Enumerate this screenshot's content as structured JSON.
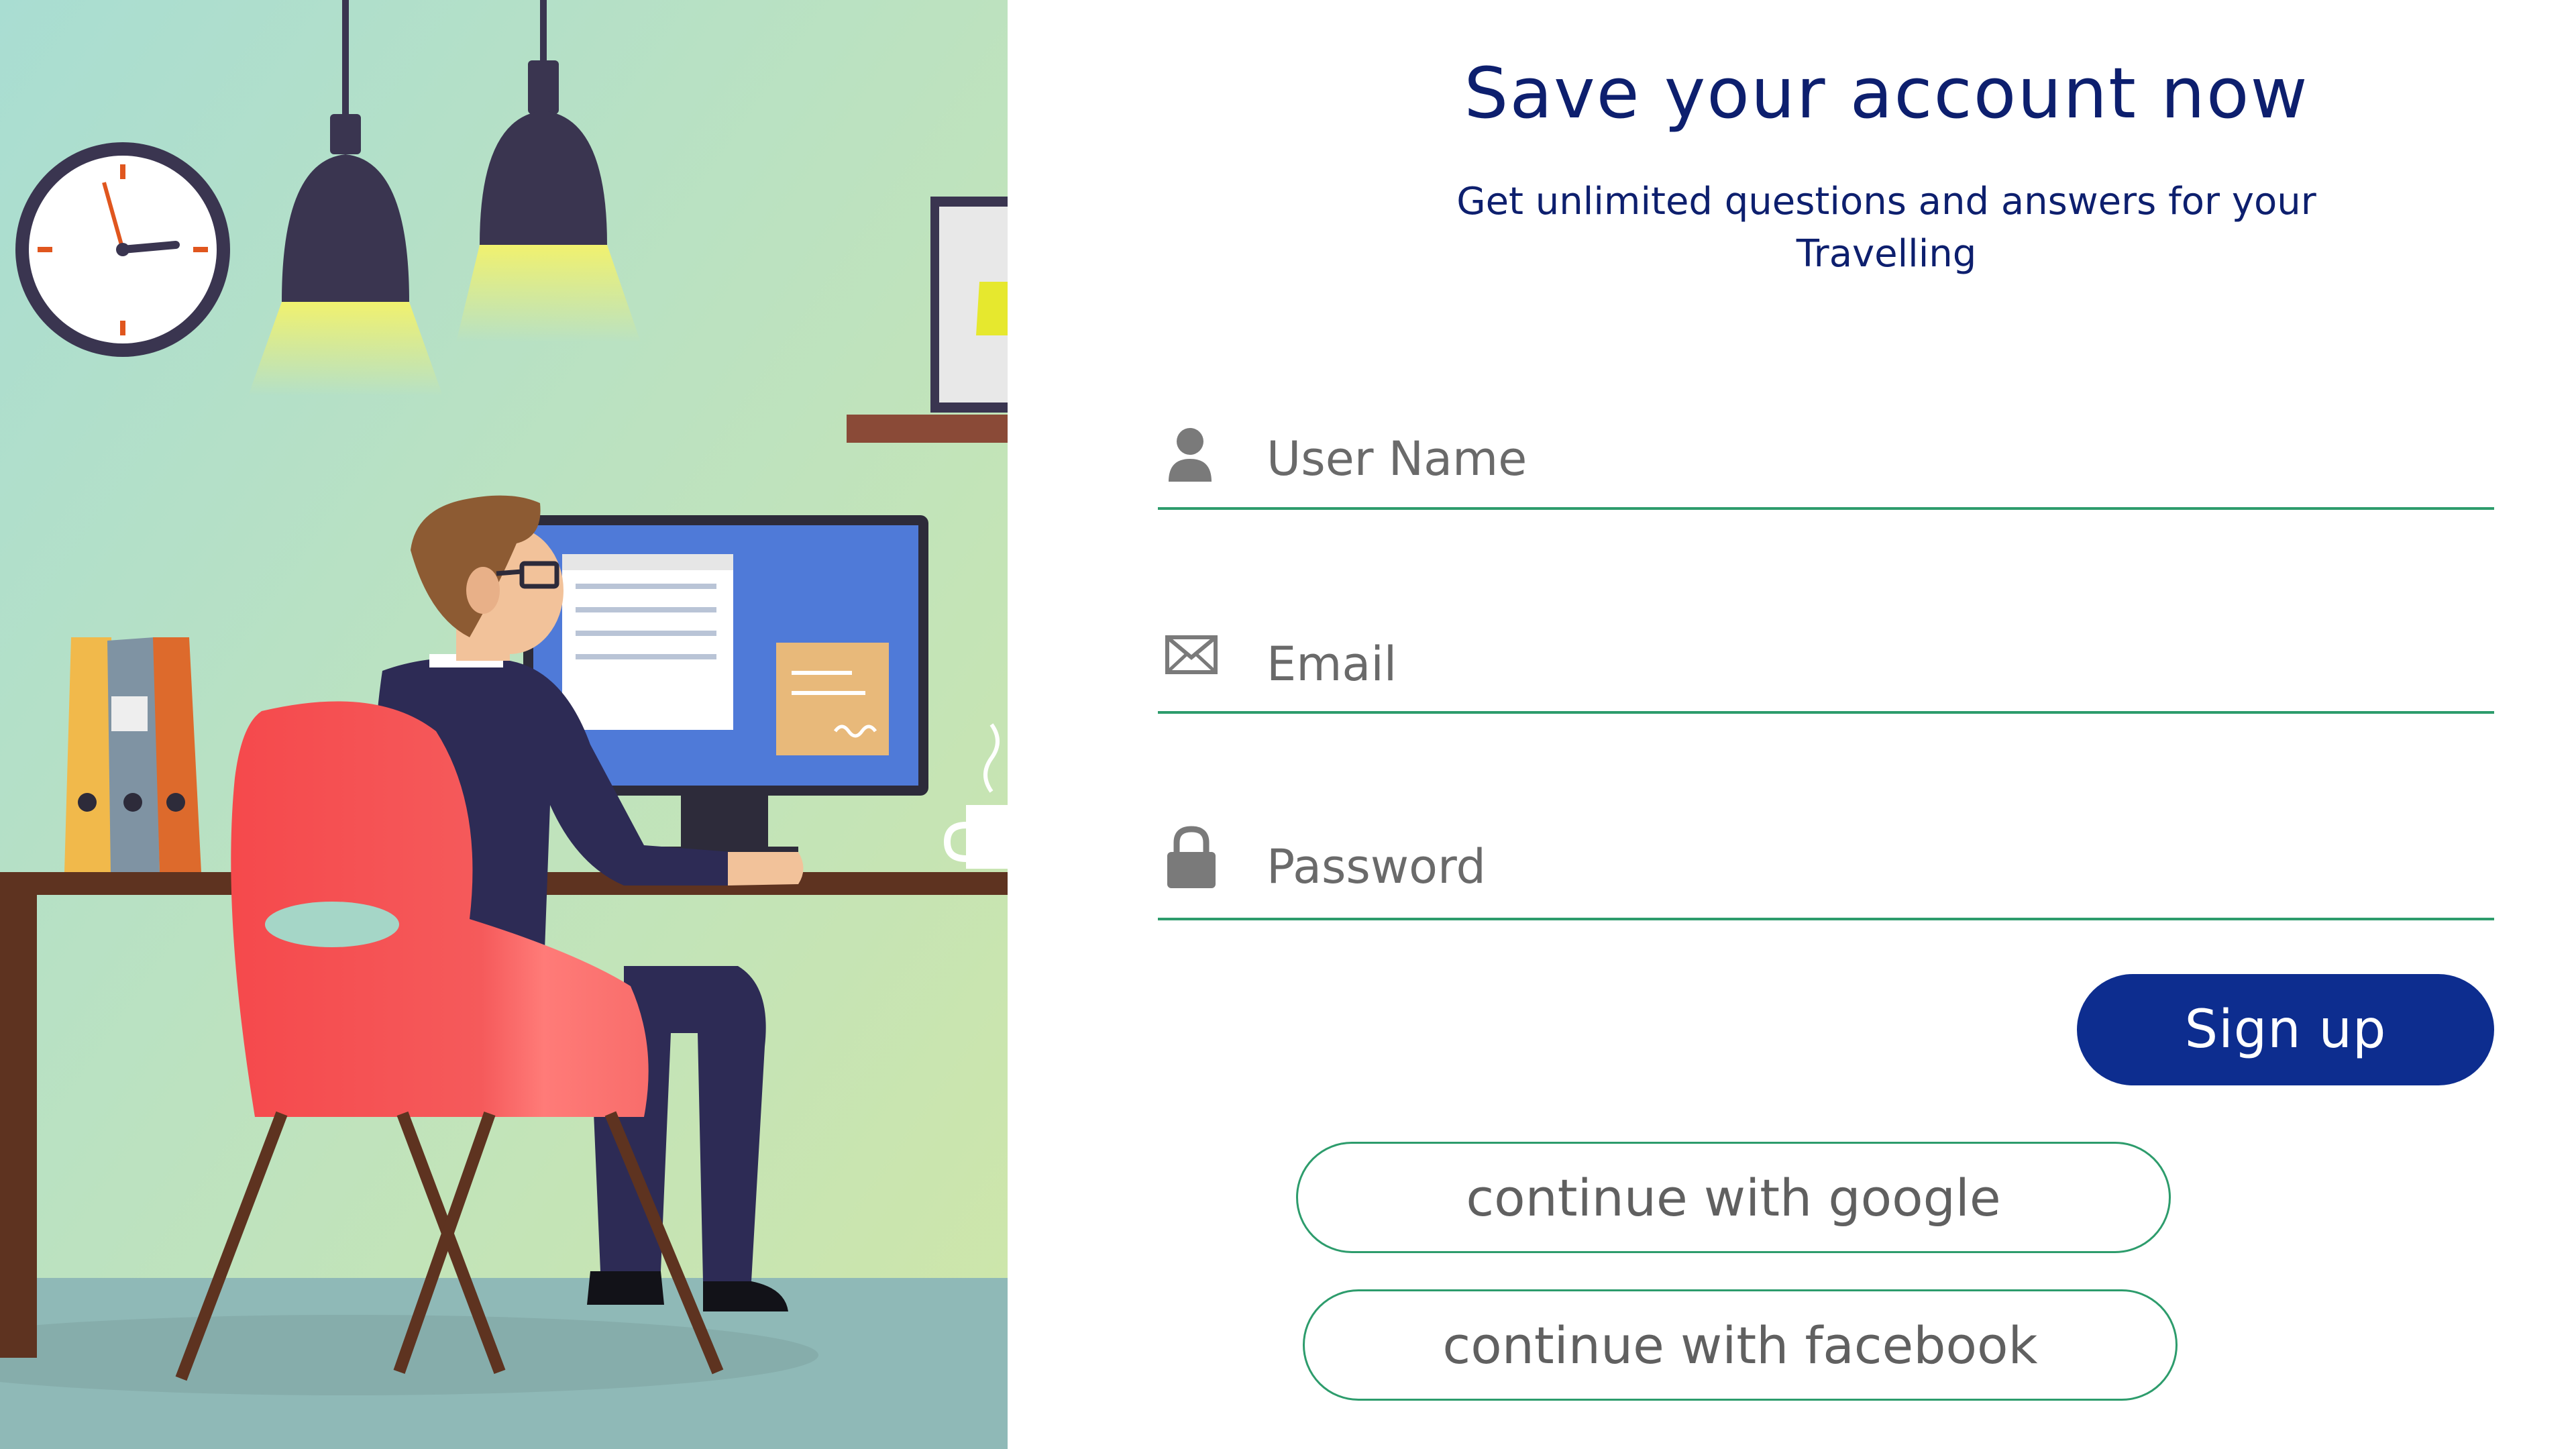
{
  "header": {
    "title": "Save your account now",
    "subtitle_line1": "Get unlimited questions and answers for your",
    "subtitle_line2": "Travelling"
  },
  "form": {
    "username": {
      "placeholder": "User Name",
      "value": "",
      "icon": "user-icon"
    },
    "email": {
      "placeholder": "Email",
      "value": "",
      "icon": "envelope-icon"
    },
    "password": {
      "placeholder": "Password",
      "value": "",
      "icon": "lock-icon"
    },
    "signup_label": "Sign up"
  },
  "social": {
    "google_label": "continue with google",
    "facebook_label": "continue with facebook"
  },
  "colors": {
    "title_text": "#0d1f6e",
    "primary_button": "#0d2d8f",
    "accent_line": "#2d9c6c",
    "placeholder_text": "#6a6a6a"
  },
  "illustration": {
    "description_icon": "office-worker-illustration"
  }
}
